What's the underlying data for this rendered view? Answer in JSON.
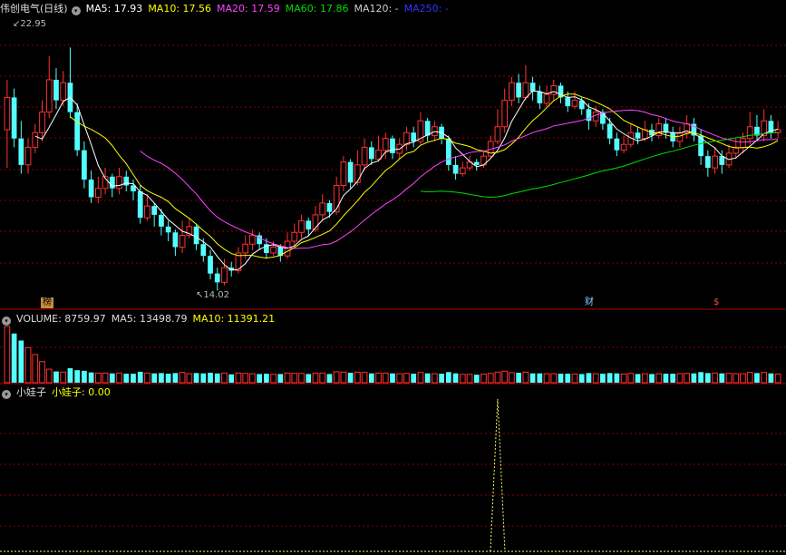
{
  "main": {
    "title": "伟创电气(日线)",
    "ma_labels": [
      {
        "text": "MA5: 17.93",
        "color": "#ffffff"
      },
      {
        "text": "MA10: 17.56",
        "color": "#ffff00"
      },
      {
        "text": "MA20: 17.59",
        "color": "#ff44ff"
      },
      {
        "text": "MA60: 17.86",
        "color": "#00dd00"
      },
      {
        "text": "MA120: -",
        "color": "#cccccc"
      },
      {
        "text": "MA250: -",
        "color": "#3333ff"
      }
    ],
    "high_label": "22.95",
    "low_label": "14.02",
    "markers": {
      "bang": "榜",
      "cai": "财",
      "dollar": "$"
    }
  },
  "volume": {
    "title": "VOLUME: 8759.97",
    "ma5": "MA5: 13498.79",
    "ma10": "MA10: 11391.21"
  },
  "indicator": {
    "title": "小娃子",
    "value": "小娃子: 0.00"
  },
  "colors": {
    "up": "#ff3232",
    "down": "#54ffff",
    "grid": "#8b0000",
    "ma5": "#ffffff",
    "ma10": "#ffff00",
    "ma20": "#ff44ff",
    "ma60": "#00dd00",
    "signal": "#ffff66"
  },
  "chart_data": {
    "type": "candlestick",
    "title": "伟创电气(日线)",
    "price_high": 22.95,
    "price_low": 14.02,
    "candles": [
      [
        19.5,
        20.6,
        21.2,
        18.2
      ],
      [
        20.6,
        19.2,
        20.9,
        18.9
      ],
      [
        19.2,
        18.3,
        19.8,
        18.0
      ],
      [
        18.3,
        18.9,
        19.2,
        18.0
      ],
      [
        18.9,
        19.4,
        19.7,
        18.7
      ],
      [
        19.4,
        20.1,
        20.5,
        19.1
      ],
      [
        20.1,
        21.2,
        22.0,
        19.9
      ],
      [
        21.2,
        20.5,
        21.6,
        20.2
      ],
      [
        20.5,
        21.1,
        21.5,
        20.3
      ],
      [
        21.1,
        20.1,
        22.3,
        19.9
      ],
      [
        20.1,
        18.8,
        20.4,
        18.6
      ],
      [
        18.8,
        17.8,
        19.1,
        17.5
      ],
      [
        17.8,
        17.2,
        18.1,
        17.0
      ],
      [
        17.2,
        17.5,
        17.9,
        17.0
      ],
      [
        17.5,
        17.9,
        18.2,
        17.3
      ],
      [
        17.9,
        17.5,
        18.0,
        17.2
      ],
      [
        17.5,
        17.9,
        18.2,
        17.3
      ],
      [
        17.9,
        17.6,
        18.1,
        17.4
      ],
      [
        17.6,
        17.4,
        17.8,
        17.1
      ],
      [
        17.4,
        16.5,
        17.6,
        16.3
      ],
      [
        16.5,
        16.9,
        17.3,
        16.4
      ],
      [
        16.9,
        16.6,
        17.0,
        16.2
      ],
      [
        16.6,
        16.2,
        16.8,
        15.9
      ],
      [
        16.2,
        16.0,
        16.4,
        15.7
      ],
      [
        16.0,
        15.5,
        16.1,
        15.2
      ],
      [
        15.5,
        15.9,
        16.4,
        15.3
      ],
      [
        15.9,
        16.2,
        16.5,
        15.8
      ],
      [
        16.2,
        15.6,
        16.3,
        15.4
      ],
      [
        15.6,
        15.2,
        15.8,
        15.0
      ],
      [
        15.2,
        14.6,
        15.4,
        14.4
      ],
      [
        14.6,
        14.3,
        14.8,
        14.02
      ],
      [
        14.3,
        14.8,
        15.1,
        14.2
      ],
      [
        14.8,
        14.7,
        15.0,
        14.5
      ],
      [
        14.7,
        15.3,
        15.5,
        14.6
      ],
      [
        15.3,
        15.6,
        15.9,
        15.1
      ],
      [
        15.6,
        15.9,
        16.1,
        15.4
      ],
      [
        15.9,
        15.6,
        16.0,
        15.4
      ],
      [
        15.6,
        15.3,
        15.8,
        15.1
      ],
      [
        15.3,
        15.5,
        15.7,
        15.2
      ],
      [
        15.5,
        15.2,
        15.6,
        15.0
      ],
      [
        15.2,
        15.7,
        16.0,
        15.1
      ],
      [
        15.7,
        16.0,
        16.3,
        15.5
      ],
      [
        16.0,
        16.4,
        16.6,
        15.8
      ],
      [
        16.4,
        16.1,
        16.5,
        15.9
      ],
      [
        16.1,
        16.6,
        16.9,
        16.0
      ],
      [
        16.6,
        17.0,
        17.3,
        16.4
      ],
      [
        17.0,
        16.7,
        17.1,
        16.5
      ],
      [
        16.7,
        17.6,
        17.9,
        16.6
      ],
      [
        17.6,
        18.4,
        18.6,
        17.4
      ],
      [
        18.4,
        17.7,
        18.5,
        17.5
      ],
      [
        17.7,
        18.3,
        18.8,
        17.6
      ],
      [
        18.3,
        18.9,
        19.2,
        18.1
      ],
      [
        18.9,
        18.5,
        19.1,
        18.3
      ],
      [
        18.5,
        18.8,
        19.3,
        18.4
      ],
      [
        18.8,
        19.2,
        19.4,
        18.5
      ],
      [
        19.2,
        18.7,
        19.3,
        18.5
      ],
      [
        18.7,
        19.0,
        19.2,
        18.5
      ],
      [
        19.0,
        19.4,
        19.6,
        18.8
      ],
      [
        19.4,
        19.1,
        19.6,
        18.9
      ],
      [
        19.1,
        19.8,
        20.1,
        19.0
      ],
      [
        19.8,
        19.3,
        19.9,
        19.1
      ],
      [
        19.3,
        19.6,
        19.8,
        19.1
      ],
      [
        19.6,
        19.2,
        19.7,
        19.0
      ],
      [
        19.2,
        18.3,
        19.3,
        18.1
      ],
      [
        18.3,
        18.0,
        18.6,
        17.8
      ],
      [
        18.0,
        18.2,
        18.4,
        17.9
      ],
      [
        18.2,
        18.4,
        18.6,
        18.1
      ],
      [
        18.4,
        18.3,
        18.5,
        18.1
      ],
      [
        18.3,
        18.6,
        18.8,
        18.2
      ],
      [
        18.6,
        19.1,
        19.3,
        18.5
      ],
      [
        19.1,
        19.6,
        20.2,
        19.0
      ],
      [
        19.6,
        20.5,
        20.9,
        19.4
      ],
      [
        20.5,
        21.1,
        21.3,
        20.3
      ],
      [
        21.1,
        20.6,
        21.4,
        20.4
      ],
      [
        20.6,
        21.1,
        21.7,
        20.5
      ],
      [
        21.1,
        20.8,
        21.3,
        20.5
      ],
      [
        20.8,
        20.4,
        21.0,
        20.2
      ],
      [
        20.4,
        20.7,
        21.0,
        20.3
      ],
      [
        20.7,
        21.0,
        21.2,
        20.5
      ],
      [
        21.0,
        20.6,
        21.1,
        20.4
      ],
      [
        20.6,
        20.3,
        20.8,
        20.1
      ],
      [
        20.3,
        20.5,
        20.8,
        20.2
      ],
      [
        20.5,
        20.2,
        20.6,
        20.0
      ],
      [
        20.2,
        19.8,
        20.4,
        19.5
      ],
      [
        19.8,
        20.1,
        20.3,
        19.6
      ],
      [
        20.1,
        19.7,
        20.2,
        19.5
      ],
      [
        19.7,
        19.2,
        19.9,
        19.0
      ],
      [
        19.2,
        18.8,
        19.4,
        18.6
      ],
      [
        18.8,
        19.0,
        19.3,
        18.7
      ],
      [
        19.0,
        19.4,
        19.7,
        18.9
      ],
      [
        19.4,
        19.2,
        19.6,
        19.0
      ],
      [
        19.2,
        19.5,
        19.8,
        19.1
      ],
      [
        19.5,
        19.3,
        19.7,
        19.1
      ],
      [
        19.3,
        19.7,
        19.9,
        19.2
      ],
      [
        19.7,
        19.4,
        19.9,
        19.2
      ],
      [
        19.4,
        19.1,
        19.6,
        18.9
      ],
      [
        19.1,
        19.4,
        19.6,
        18.9
      ],
      [
        19.4,
        19.7,
        20.0,
        19.2
      ],
      [
        19.7,
        19.3,
        19.9,
        19.1
      ],
      [
        19.3,
        18.6,
        19.5,
        18.3
      ],
      [
        18.6,
        18.2,
        18.8,
        17.9
      ],
      [
        18.2,
        18.6,
        18.9,
        18.0
      ],
      [
        18.6,
        18.3,
        18.8,
        18.0
      ],
      [
        18.3,
        18.7,
        19.0,
        18.2
      ],
      [
        18.7,
        18.9,
        19.2,
        18.5
      ],
      [
        18.9,
        19.2,
        19.4,
        18.7
      ],
      [
        19.2,
        19.6,
        20.1,
        19.0
      ],
      [
        19.6,
        19.3,
        20.0,
        19.1
      ],
      [
        19.3,
        19.8,
        20.2,
        19.1
      ],
      [
        19.8,
        19.4,
        20.0,
        19.2
      ],
      [
        19.4,
        19.5,
        19.8,
        19.2
      ]
    ],
    "volume_ma5": "13498.79",
    "volume_ma10": "11391.21",
    "indicator_series": "小娃子"
  }
}
